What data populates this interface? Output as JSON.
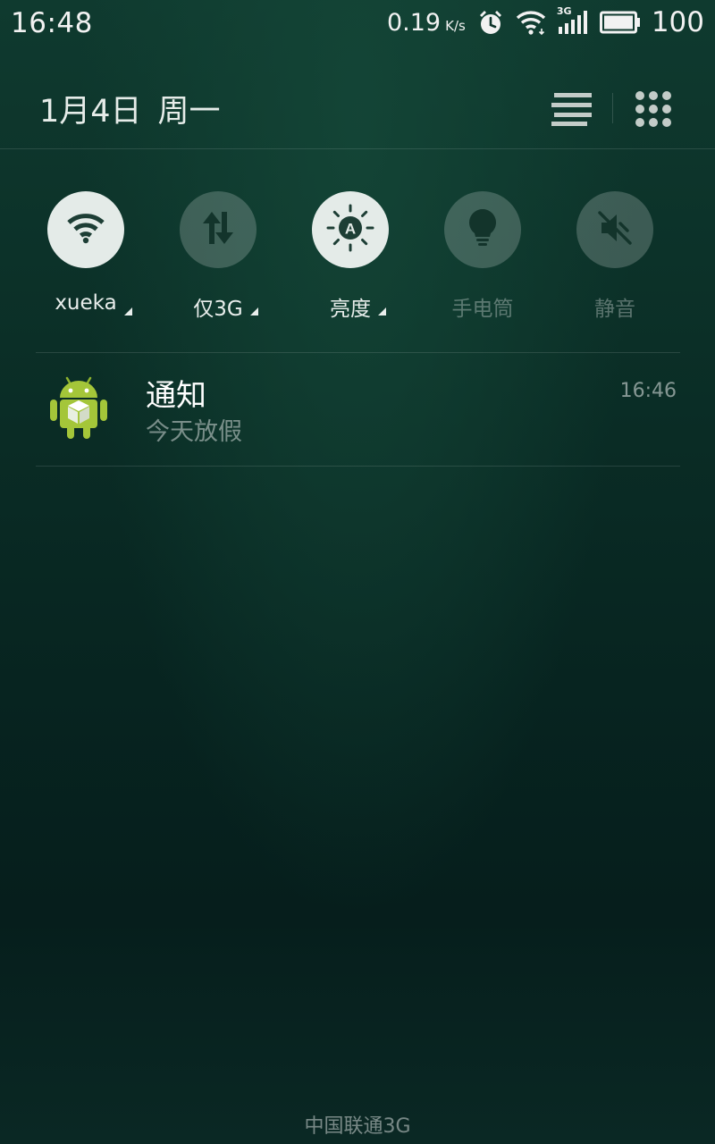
{
  "status_bar": {
    "time": "16:48",
    "net_speed_value": "0.19",
    "net_speed_unit": "K/s",
    "network_type": "3G",
    "battery_level": "100",
    "icons": [
      "alarm-icon",
      "wifi-icon",
      "cell-signal-icon",
      "battery-icon"
    ]
  },
  "header": {
    "date": "1月4日",
    "weekday": "周一",
    "icons": [
      "list-icon",
      "grid-icon"
    ]
  },
  "toggles": [
    {
      "label": "xueka",
      "icon": "wifi-icon",
      "state": "on",
      "has_menu": true
    },
    {
      "label": "仅3G",
      "icon": "mobile-data-icon",
      "state": "off",
      "has_menu": true
    },
    {
      "label": "亮度",
      "icon": "auto-brightness-icon",
      "state": "on",
      "has_menu": true
    },
    {
      "label": "手电筒",
      "icon": "flashlight-icon",
      "state": "off",
      "has_menu": false
    },
    {
      "label": "静音",
      "icon": "mute-icon",
      "state": "off",
      "has_menu": false
    }
  ],
  "notifications": [
    {
      "app_icon": "android-app-icon",
      "title": "通知",
      "body": "今天放假",
      "time": "16:46"
    }
  ],
  "carrier": "中国联通3G",
  "colors": {
    "background_top": "#0f3a2f",
    "background_bottom": "#061e1c",
    "toggle_on": "#e4ebe8",
    "toggle_icon_on": "#1d3e35",
    "android_green": "#a4c639"
  }
}
